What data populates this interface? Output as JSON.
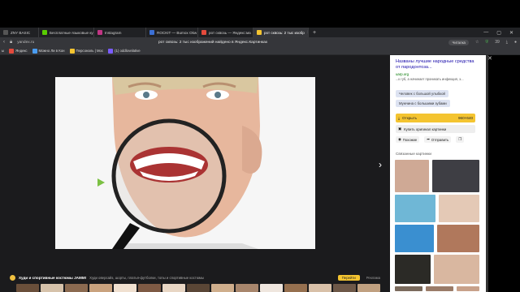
{
  "tabs": [
    {
      "label": "ZNY BASIC",
      "color": "#555"
    },
    {
      "label": "Бесплатные языковые ку",
      "color": "#58cc02"
    },
    {
      "label": "Instagram",
      "color": "#c13584"
    },
    {
      "label": "ROCKIT — Bumox Okw",
      "color": "#3b6fd4"
    },
    {
      "label": "рот сквозь — Яндекс:ма",
      "color": "#e34a3c"
    },
    {
      "label": "рот сквозь: 2 тыс изобр",
      "color": "#f4c430"
    }
  ],
  "window_controls": {
    "minimize": "—",
    "restore": "▢",
    "close": "✕"
  },
  "address": {
    "url": "yandex.ru",
    "title": "рот сквозь: 2 тыс изображений найдено в Яндекс.Картинках",
    "reader": "Читалка",
    "count": "39"
  },
  "bookmarks": [
    {
      "label": "ы",
      "color": "#555"
    },
    {
      "label": "Яндекс",
      "color": "#e34a3c"
    },
    {
      "label": "Можно Ли в Кон",
      "color": "#4a9cf0"
    },
    {
      "label": "Персональ | Moc",
      "color": "#f4c430"
    },
    {
      "label": "(1) oddlovelative",
      "color": "#7a5cff"
    }
  ],
  "viewer": {
    "next_icon": "›",
    "ad": {
      "title": "Худи и спортивные костюмы JAMM!",
      "description": "Худи оверсайз, шорты, платья-футболки, топы и спортивные костюмы",
      "button": "Перейти",
      "label": "Реклама"
    },
    "thumb_colors": [
      "#6a4f3a",
      "#d6c2aa",
      "#8b6a50",
      "#c9a27e",
      "#f0e0d0",
      "#7e5a44",
      "#e8d6c4",
      "#5a4636",
      "#cfae8c",
      "#a8866c",
      "#efe6de",
      "#96704f",
      "#d8c0a8",
      "#6e5848",
      "#c0a080"
    ]
  },
  "panel": {
    "title": "Названы лучшие народные средства от пародонтоза...",
    "domain": "uarp.org",
    "snippet": "...к губ, а начинает проникать инфекция, э...",
    "tags": [
      "Человек с большой улыбкой",
      "Мужчина с большими зубами"
    ],
    "open_label": "Открыть",
    "size": "960×640",
    "buy_label": "Купить оригинал картинки",
    "similar_label": "Похожие",
    "share_label": "Отправить",
    "related_label": "Связанные картинки",
    "grid_colors": [
      "#cfa995",
      "#3e3e44",
      "#6fb7d6",
      "#e4c9b6",
      "#3a8fd0",
      "#b0785c",
      "#2b2a26",
      "#d9b7a0",
      "#7a6a5c",
      "#9a7b68",
      "#c8a18a",
      "#55473e"
    ]
  },
  "colors": {
    "accent": "#f4c430",
    "link": "#1a0dab"
  }
}
